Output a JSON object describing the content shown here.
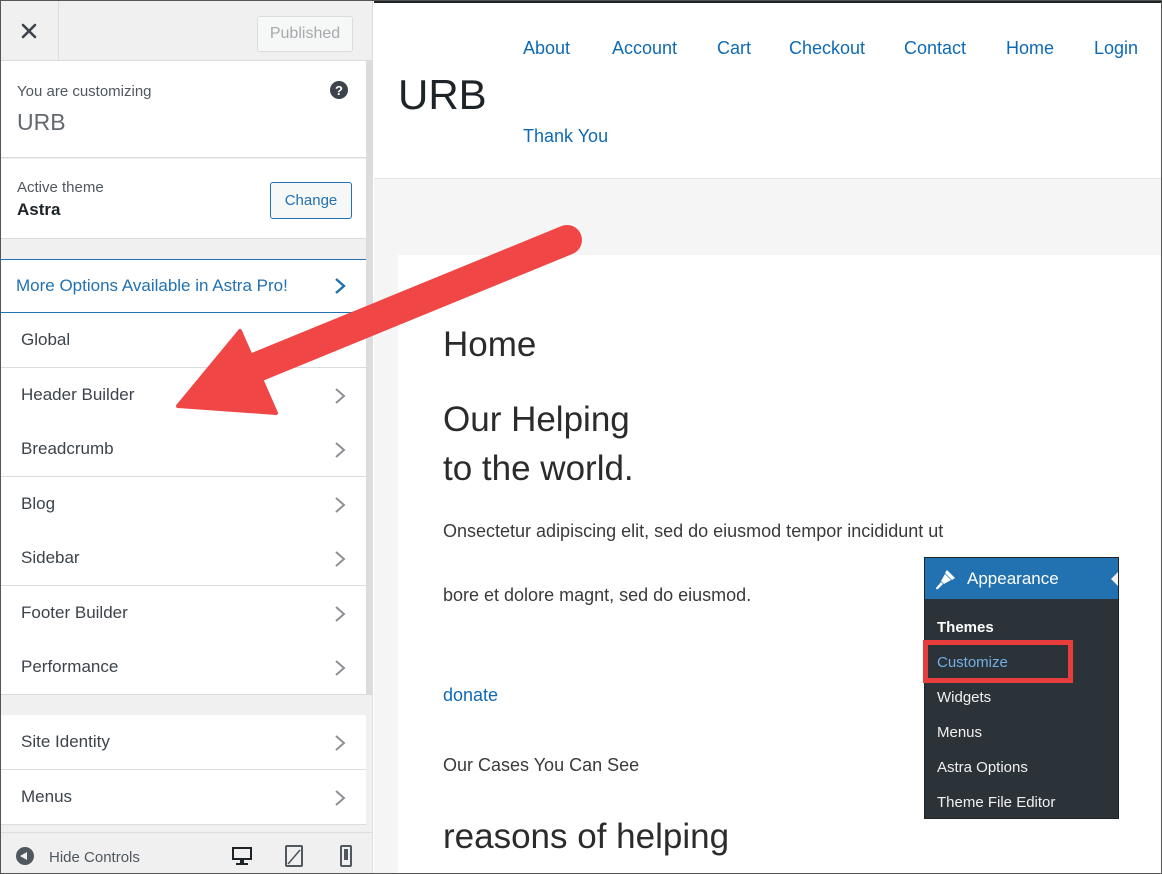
{
  "customizer": {
    "publish_label": "Published",
    "customizing_label": "You are customizing",
    "site_name": "URB",
    "active_theme_label": "Active theme",
    "active_theme_name": "Astra",
    "change_label": "Change",
    "pro_label": "More Options Available in Astra Pro!",
    "sections": [
      {
        "label": "Global"
      },
      {
        "label": "Header Builder"
      },
      {
        "label": "Breadcrumb"
      },
      {
        "label": "Blog"
      },
      {
        "label": "Sidebar"
      },
      {
        "label": "Footer Builder"
      },
      {
        "label": "Performance"
      },
      {
        "label": "Site Identity"
      },
      {
        "label": "Menus"
      }
    ],
    "hide_controls_label": "Hide Controls"
  },
  "preview": {
    "site_title": "URB",
    "nav": [
      "About",
      "Account",
      "Cart",
      "Checkout",
      "Contact",
      "Home",
      "Login",
      "Thank You"
    ],
    "page_heading": "Home",
    "hero_line1": "Our Helping",
    "hero_line2": "to the world.",
    "para1": "Onsectetur adipiscing elit, sed do eiusmod tempor incididunt ut",
    "para2": "bore et dolore magnt, sed do eiusmod.",
    "donate": "donate",
    "cases": "Our Cases You Can See",
    "reasons_heading": "reasons of helping"
  },
  "appearance_menu": {
    "title": "Appearance",
    "items": [
      "Themes",
      "Customize",
      "Widgets",
      "Menus",
      "Astra Options",
      "Theme File Editor"
    ]
  },
  "colors": {
    "wp_blue": "#2271b1",
    "link_blue": "#0f6ab4",
    "annotation_red": "#e93c3c",
    "admin_dark": "#2c3338"
  },
  "icons": {
    "close": "close-icon",
    "help": "help-icon",
    "chevron": "chevron-right-icon",
    "collapse": "collapse-sidebar-icon",
    "desktop": "desktop-icon",
    "tablet": "tablet-icon",
    "mobile": "mobile-icon",
    "brush": "paintbrush-icon",
    "annotation": "red-arrow-icon"
  }
}
